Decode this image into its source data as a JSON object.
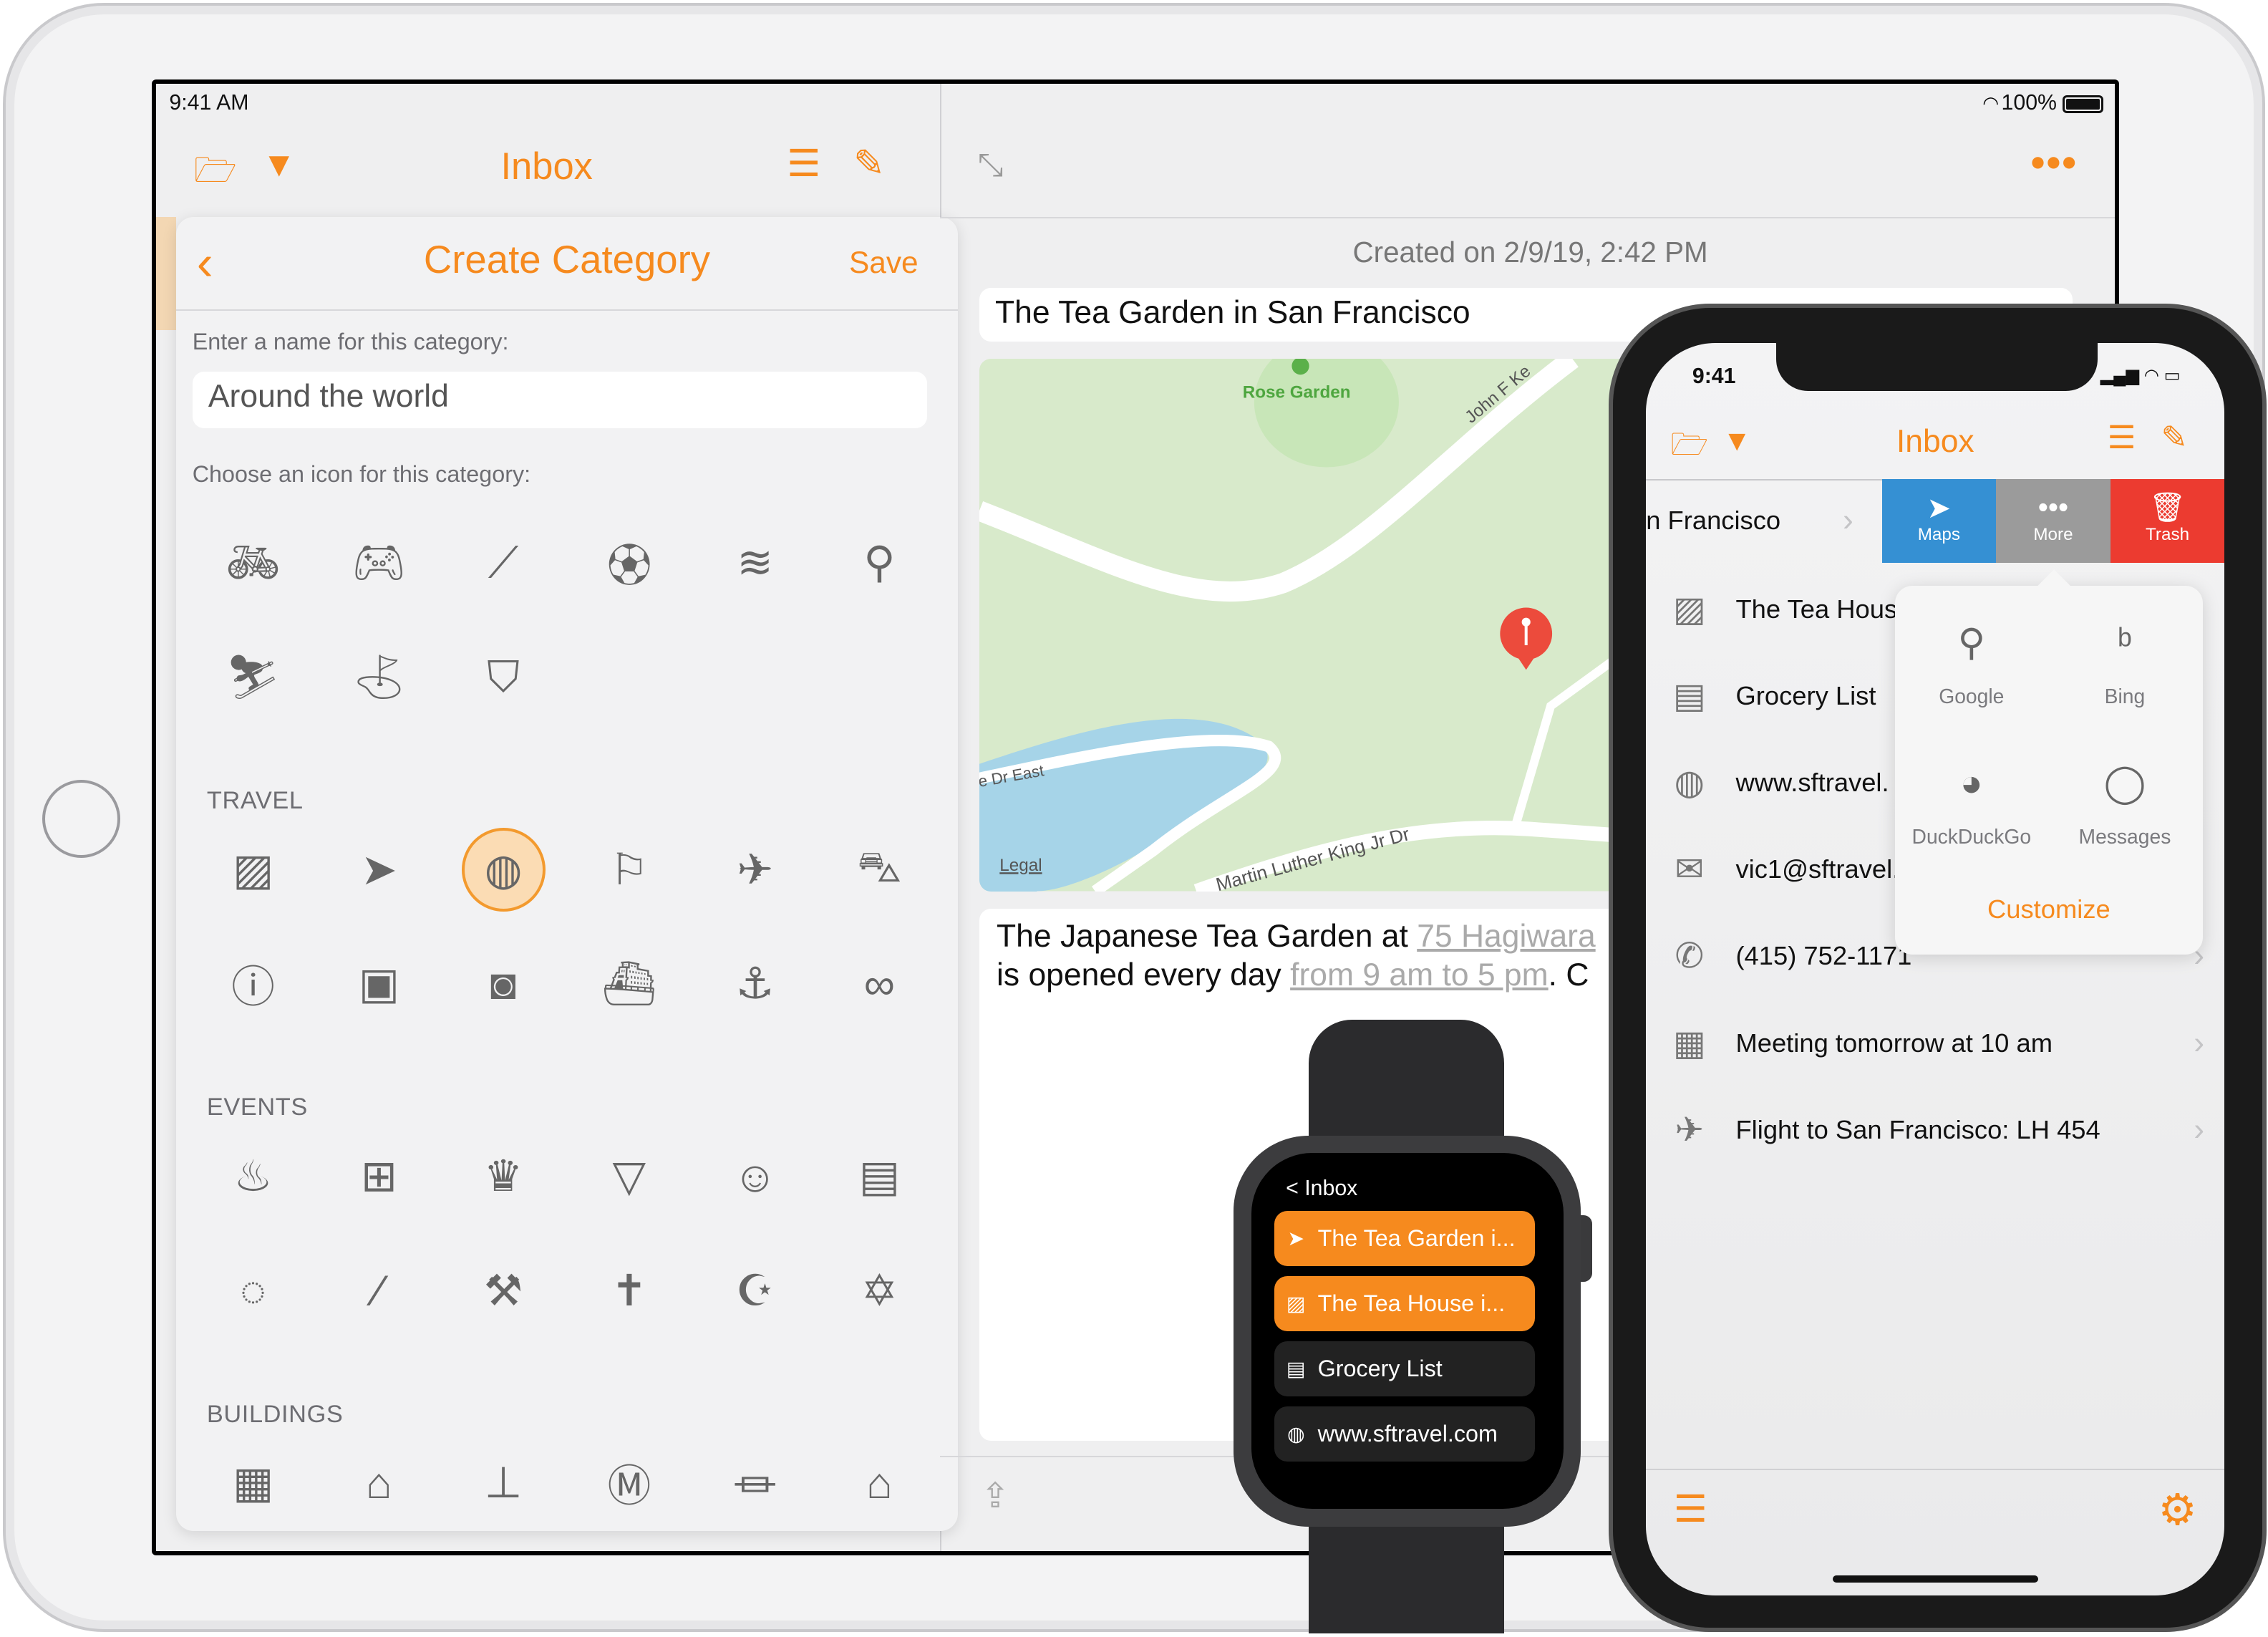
{
  "ipad": {
    "status": {
      "time": "9:41 AM",
      "battery": "100%"
    },
    "left_nav": {
      "title": "Inbox",
      "icons": [
        "folder-open-icon",
        "filter-icon",
        "list-add-icon",
        "compose-icon"
      ]
    },
    "create_category": {
      "back_icon": "chevron-left-icon",
      "title": "Create Category",
      "save_label": "Save",
      "name_label": "Enter a name for this category:",
      "name_value": "Around the world",
      "icon_label": "Choose an icon for this category:",
      "sections": [
        {
          "title": "",
          "icons": [
            "bicycle",
            "gamepad",
            "baseball-bat",
            "soccer-ball",
            "swimmer",
            "ping-pong",
            "skier",
            "golf-flag",
            "hockey-mask"
          ]
        },
        {
          "title": "TRAVEL",
          "icons": [
            "image",
            "location-arrow",
            "globe",
            "flag",
            "airplane",
            "car",
            "info",
            "suitcase",
            "camera",
            "ship",
            "anchor",
            "binoculars"
          ],
          "selected": "globe"
        },
        {
          "title": "EVENTS",
          "icons": [
            "birthday-cake",
            "gift",
            "trophy",
            "cocktail",
            "theater-masks",
            "film",
            "chat-bubbles",
            "magic-wand",
            "gavel",
            "cross",
            "star-and-crescent",
            "star-of-david"
          ]
        },
        {
          "title": "BUILDINGS",
          "icons": [
            "building",
            "factory",
            "monument",
            "museum-m",
            "bank",
            "garage"
          ]
        }
      ]
    },
    "detail": {
      "created": "Created on 2/9/19, 2:42 PM",
      "title": "The Tea Garden in San Francisco",
      "map": {
        "labels": {
          "poi": "Rose Garden",
          "road1": "John F Ke",
          "road2": "e Dr East",
          "road3": "Martin Luther King Jr Dr",
          "legal": "Legal"
        }
      },
      "note": {
        "line1_text": "The Japanese Tea Garden at ",
        "line1_link": "75 Hagiwara",
        "line2_text": "is opened every day ",
        "line2_link": "from 9 am to 5 pm",
        "line2_tail": ". C"
      }
    }
  },
  "watch": {
    "back": "< Inbox",
    "items": [
      {
        "icon": "location-arrow-icon",
        "label": "The Tea Garden i...",
        "highlight": true
      },
      {
        "icon": "image-icon",
        "label": "The Tea House i...",
        "highlight": true
      },
      {
        "icon": "document-icon",
        "label": "Grocery List",
        "highlight": false
      },
      {
        "icon": "globe-icon",
        "label": "www.sftravel.com",
        "highlight": false
      }
    ]
  },
  "iphone": {
    "status": {
      "time": "9:41"
    },
    "nav_title": "Inbox",
    "swiped_row": "n Francisco",
    "swipe_actions": [
      {
        "label": "Maps",
        "color": "#3590d3",
        "icon": "location-arrow-icon"
      },
      {
        "label": "More",
        "color": "#9b9b9b",
        "icon": "ellipsis-icon"
      },
      {
        "label": "Trash",
        "color": "#ec3b30",
        "icon": "trash-icon"
      }
    ],
    "items": [
      {
        "icon": "image-icon",
        "label": "The Tea Hous"
      },
      {
        "icon": "document-icon",
        "label": "Grocery List"
      },
      {
        "icon": "globe-icon",
        "label": "www.sftravel."
      },
      {
        "icon": "envelope-icon",
        "label": "vic1@sftravel."
      },
      {
        "icon": "phone-icon",
        "label": "(415) 752-1171"
      },
      {
        "icon": "calendar-icon",
        "label": "Meeting tomorrow at 10 am"
      },
      {
        "icon": "airplane-icon",
        "label": "Flight to San Francisco: LH 454"
      }
    ],
    "more_popover": {
      "options": [
        {
          "icon": "search-icon",
          "label": "Google"
        },
        {
          "icon": "bing-icon",
          "label": "Bing"
        },
        {
          "icon": "duckduckgo-icon",
          "label": "DuckDuckGo"
        },
        {
          "icon": "speech-bubble-icon",
          "label": "Messages"
        }
      ],
      "customize": "Customize"
    }
  },
  "colors": {
    "accent": "#f68a1e",
    "maps": "#3590d3",
    "more": "#9b9b9b",
    "trash": "#ec3b30"
  }
}
